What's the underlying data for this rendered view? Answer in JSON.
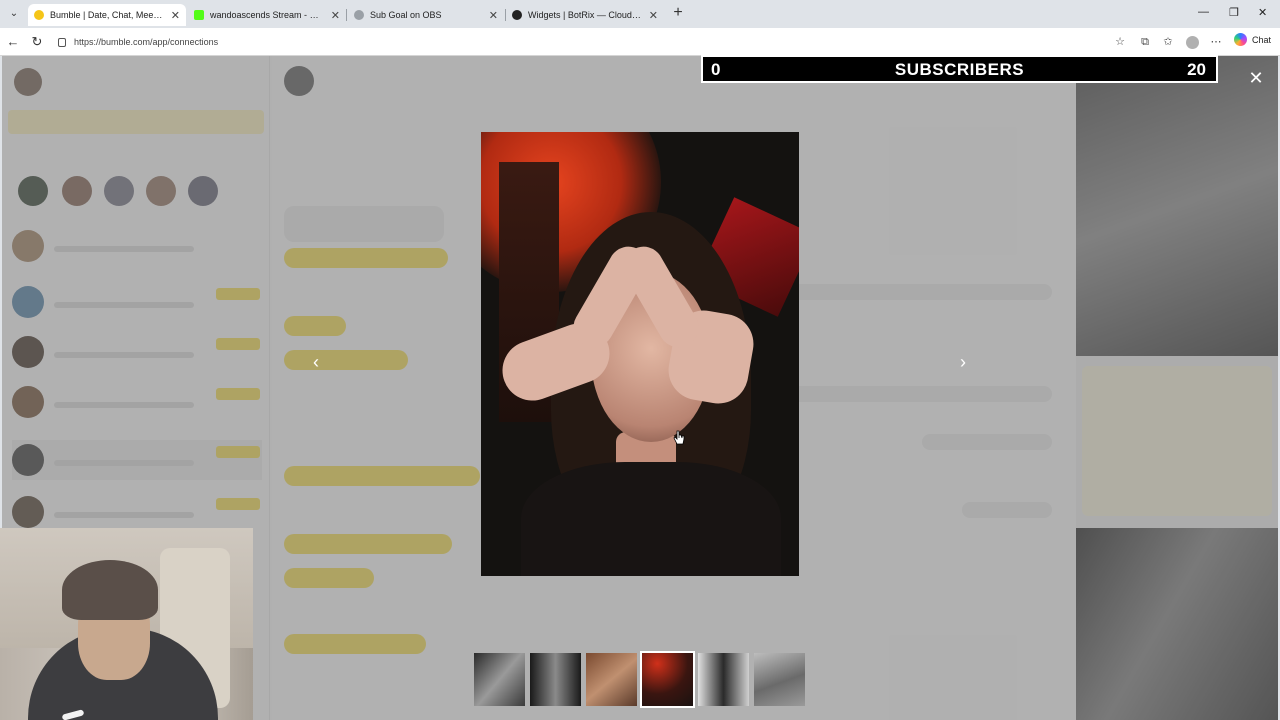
{
  "browser": {
    "tabs": [
      {
        "label": "Bumble | Date, Chat, Meet New Pe",
        "active": true,
        "favicon_color": "#f5c518"
      },
      {
        "label": "wandoascends Stream - Watch Liv",
        "active": false,
        "favicon_color": "#53fc18"
      },
      {
        "label": "Sub Goal on OBS",
        "active": false,
        "favicon_color": "#9aa0a6"
      },
      {
        "label": "Widgets | BotRix — Cloud Stream",
        "active": false,
        "favicon_color": "#222222"
      }
    ],
    "url": "https://bumble.com/app/connections",
    "chat_label": "Chat",
    "icons": {
      "tab_menu": "chevron-down-icon",
      "close": "close-icon",
      "new_tab": "plus-icon",
      "minimize": "minimize-icon",
      "restore": "restore-icon",
      "back": "back-arrow-icon",
      "reload": "reload-icon",
      "favorite": "star-icon",
      "extensions": "puzzle-icon",
      "favorites": "favorites-icon",
      "profile": "profile-icon",
      "more": "more-icon"
    }
  },
  "overlay": {
    "prev_glyph": "‹",
    "next_glyph": "›",
    "close_glyph": "✕",
    "thumbnail_count": 6,
    "active_thumbnail": 4
  },
  "subgoal": {
    "current": "0",
    "title": "SUBSCRIBERS",
    "goal": "20",
    "progress": 0
  },
  "colors": {
    "accent_yellow": "#f0d84a",
    "overlay_black": "#000000"
  }
}
